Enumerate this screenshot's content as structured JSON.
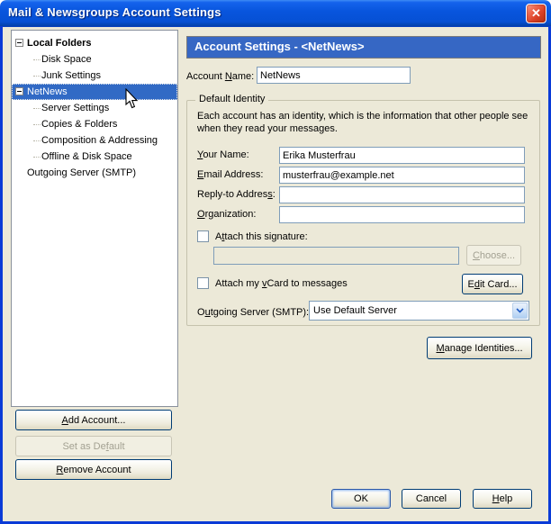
{
  "window": {
    "title": "Mail & Newsgroups Account Settings",
    "close": "✕"
  },
  "header": {
    "banner": "Account Settings - <NetNews>"
  },
  "tree": {
    "items": [
      {
        "label": "Local Folders"
      },
      {
        "label": "Disk Space"
      },
      {
        "label": "Junk Settings"
      },
      {
        "label": "NetNews"
      },
      {
        "label": "Server Settings"
      },
      {
        "label": "Copies & Folders"
      },
      {
        "label": "Composition & Addressing"
      },
      {
        "label": "Offline & Disk Space"
      },
      {
        "label": "Outgoing Server (SMTP)"
      }
    ],
    "selected": "NetNews"
  },
  "form": {
    "account_name": {
      "pre": "Account ",
      "key": "N",
      "post": "ame:",
      "value": "NetNews"
    },
    "identity": {
      "legend": "Default Identity",
      "description": "Each account has an identity, which is the information that other people see when they read your messages."
    },
    "your_name": {
      "pre": "",
      "key": "Y",
      "post": "our Name:",
      "value": "Erika Musterfrau"
    },
    "email": {
      "pre": "",
      "key": "E",
      "post": "mail Address:",
      "value": "musterfrau@example.net"
    },
    "replyto": {
      "pre": "Reply-to Addres",
      "key": "s",
      "post": ":",
      "value": ""
    },
    "organization": {
      "pre": "",
      "key": "O",
      "post": "rganization:",
      "value": ""
    },
    "attach_signature": {
      "pre": "A",
      "key": "t",
      "post": "tach this signature:",
      "checked": false,
      "value": ""
    },
    "attach_vcard": {
      "pre": "Attach my ",
      "key": "v",
      "post": "Card to messages",
      "checked": false
    },
    "outgoing_server": {
      "pre": "O",
      "key": "u",
      "post": "tgoing Server (SMTP):",
      "value": "Use Default Server"
    }
  },
  "buttons": {
    "choose": {
      "pre": "",
      "key": "C",
      "post": "hoose...",
      "enabled": false
    },
    "edit_card": {
      "pre": "E",
      "key": "d",
      "post": "it Card...",
      "enabled": true
    },
    "manage_identities": {
      "pre": "",
      "key": "M",
      "post": "anage Identities...",
      "enabled": true
    },
    "add_account": {
      "pre": "",
      "key": "A",
      "post": "dd Account...",
      "enabled": true
    },
    "set_default": {
      "pre": "Set as De",
      "key": "f",
      "post": "ault",
      "enabled": false
    },
    "remove_account": {
      "pre": "",
      "key": "R",
      "post": "emove Account",
      "enabled": true
    },
    "ok": {
      "label": "OK"
    },
    "cancel": {
      "label": "Cancel"
    },
    "help": {
      "pre": "",
      "key": "H",
      "post": "elp"
    }
  },
  "colors": {
    "background": "#ECE9D8",
    "banner_blue": "#3667C4",
    "selection_blue": "#316AC5",
    "titlebar_blue": "#0855DD",
    "frame_blue": "#0A3BD7",
    "close_red": "#DC4226",
    "input_border": "#7F9DB9"
  }
}
